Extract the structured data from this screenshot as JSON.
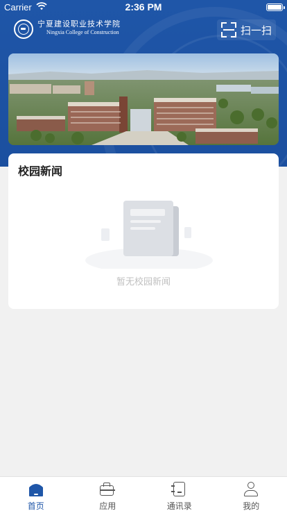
{
  "status_bar": {
    "carrier": "Carrier",
    "time": "2:36 PM"
  },
  "header": {
    "school_name_cn": "宁夏建设职业技术学院",
    "school_name_en": "Ningxia College of Construction",
    "scan_label": "扫一扫",
    "accent_color": "#1f56a8"
  },
  "news": {
    "title": "校园新闻",
    "empty_text": "暂无校园新闻"
  },
  "tabbar": {
    "items": [
      {
        "label": "首页",
        "icon": "home-icon",
        "active": true
      },
      {
        "label": "应用",
        "icon": "briefcase-icon",
        "active": false
      },
      {
        "label": "通讯录",
        "icon": "contacts-book-icon",
        "active": false
      },
      {
        "label": "我的",
        "icon": "user-icon",
        "active": false
      }
    ]
  }
}
